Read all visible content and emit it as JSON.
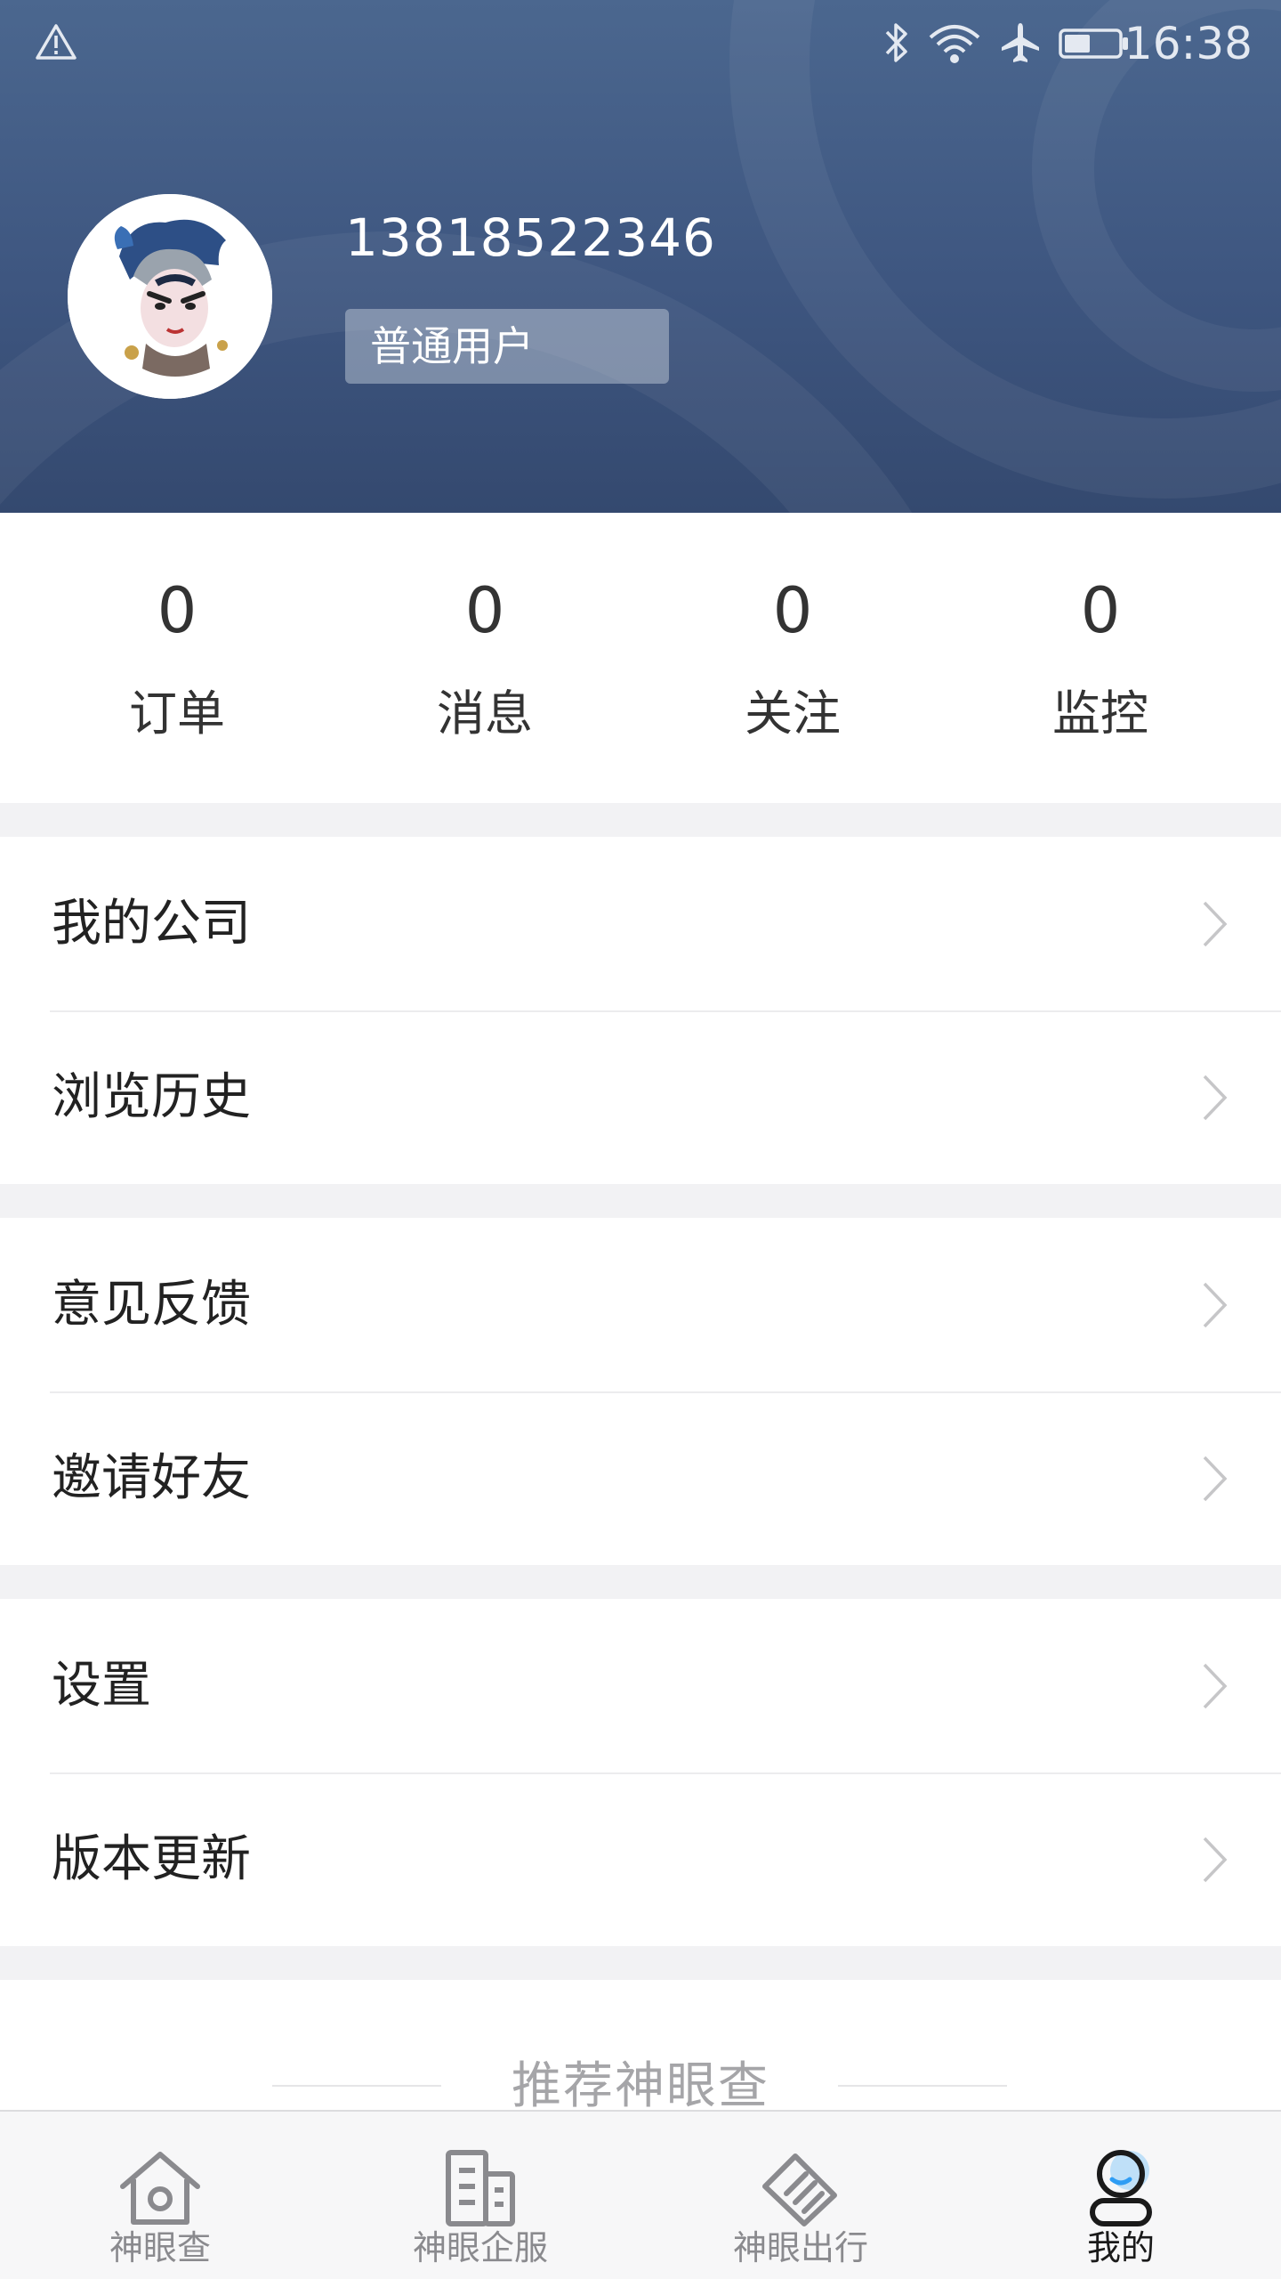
{
  "status_bar": {
    "time": "16:38"
  },
  "profile": {
    "phone": "13818522346",
    "level": "普通用户"
  },
  "stats": [
    {
      "value": "0",
      "label": "订单"
    },
    {
      "value": "0",
      "label": "消息"
    },
    {
      "value": "0",
      "label": "关注"
    },
    {
      "value": "0",
      "label": "监控"
    }
  ],
  "menu_groups": [
    [
      {
        "label": "我的公司"
      },
      {
        "label": "浏览历史"
      }
    ],
    [
      {
        "label": "意见反馈"
      },
      {
        "label": "邀请好友"
      }
    ],
    [
      {
        "label": "设置"
      },
      {
        "label": "版本更新"
      }
    ]
  ],
  "recommend": {
    "title": "推荐神眼查"
  },
  "tabs": [
    {
      "label": "神眼查",
      "icon": "home-icon",
      "active": false
    },
    {
      "label": "神眼企服",
      "icon": "building-icon",
      "active": false
    },
    {
      "label": "神眼出行",
      "icon": "handshake-icon",
      "active": false
    },
    {
      "label": "我的",
      "icon": "profile-icon",
      "active": true
    }
  ],
  "colors": {
    "header": "#3e5680",
    "text_primary": "#333333",
    "tab_inactive": "#8a8a8e",
    "tab_active": "#1a1a1a",
    "accent_blue": "#2f9df4"
  }
}
